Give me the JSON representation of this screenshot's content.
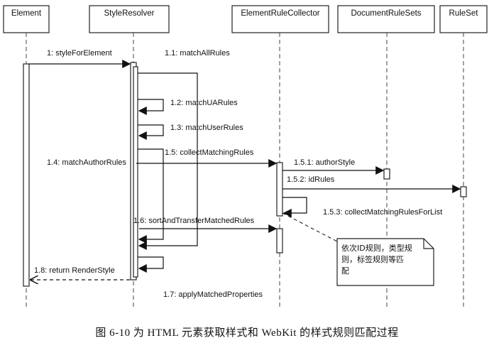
{
  "lifelines": [
    {
      "id": "element",
      "label": "Element"
    },
    {
      "id": "style-resolver",
      "label": "StyleResolver"
    },
    {
      "id": "element-rule-collector",
      "label": "ElementRuleCollector"
    },
    {
      "id": "document-rule-sets",
      "label": "DocumentRuleSets"
    },
    {
      "id": "rule-set",
      "label": "RuleSet"
    }
  ],
  "messages": {
    "m1": "1: styleForElement",
    "m1_1": "1.1: matchAllRules",
    "m1_2": "1.2: matchUARules",
    "m1_3": "1.3: matchUserRules",
    "m1_4": "1.4: matchAuthorRules",
    "m1_5": "1.5: collectMatchingRules",
    "m1_5_1": "1.5.1: authorStyle",
    "m1_5_2": "1.5.2: idRules",
    "m1_5_3": "1.5.3: collectMatchingRulesForList",
    "m1_6": "1.6: sortAndTransferMatchedRules",
    "m1_7": "1.7: applyMatchedProperties",
    "m1_8": "1.8: return RenderStyle"
  },
  "note": {
    "line1": "依次ID规则，类型规",
    "line2": "则，标签规则等匹",
    "line3": "配"
  },
  "caption": "图 6-10   为 HTML 元素获取样式和 WebKit 的样式规则匹配过程"
}
